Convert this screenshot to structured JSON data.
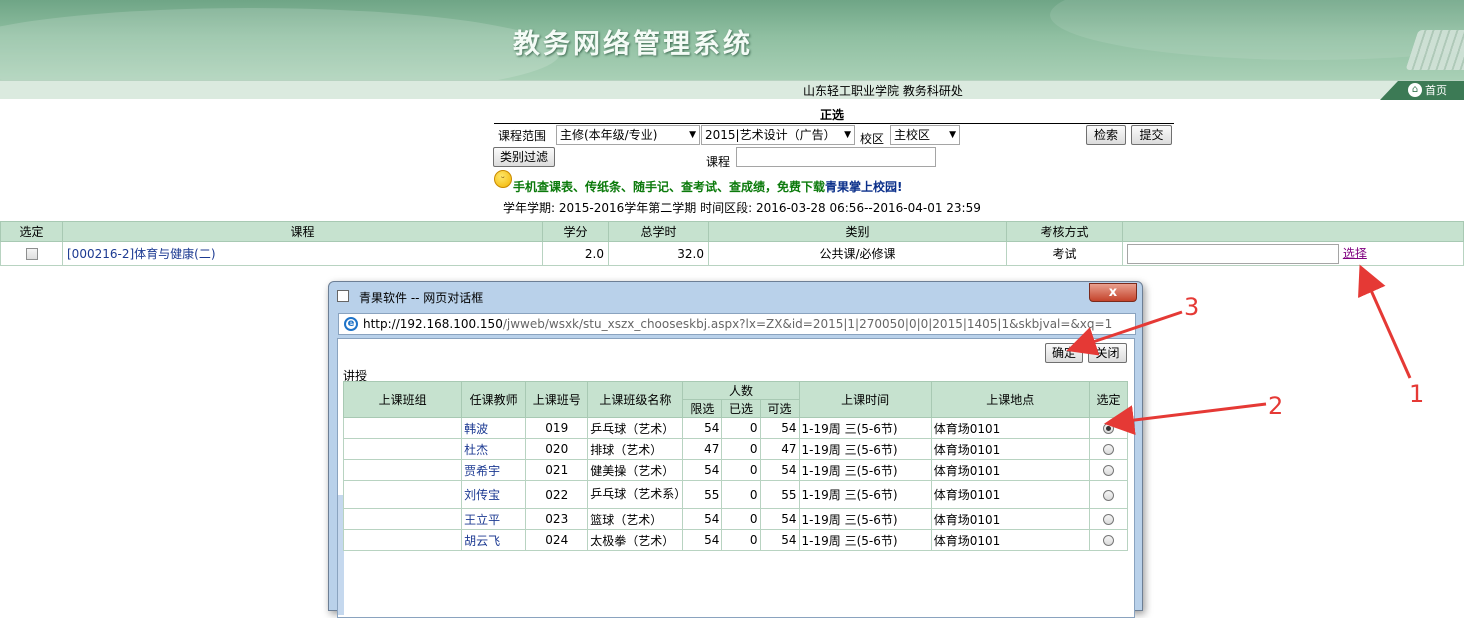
{
  "header": {
    "system_title": "教务网络管理系统",
    "org_line": "山东轻工职业学院 教务科研处",
    "home_label": "首页"
  },
  "form": {
    "heading": "正选",
    "range_label": "课程范围",
    "range_value": "主修(本年级/专业)",
    "class_value": "2015|艺术设计（广告）",
    "campus_label": "校区",
    "campus_value": "主校区",
    "search_label": "检索",
    "submit_label": "提交",
    "filter_label": "类别过滤",
    "course_label": "课程",
    "course_value": ""
  },
  "notice": {
    "part1": "手机查课表、传纸条、随手记、查考试、查成绩，免费下载",
    "part2": "青果掌上校园!"
  },
  "term_line": "学年学期: 2015-2016学年第二学期  时间区段: 2016-03-28 06:56--2016-04-01 23:59",
  "main_table": {
    "headers": [
      "选定",
      "课程",
      "学分",
      "总学时",
      "类别",
      "考核方式"
    ],
    "rows": [
      {
        "course": "[000216-2]体育与健康(二)",
        "credit": "2.0",
        "hours": "32.0",
        "category": "公共课/必修课",
        "exam": "考试",
        "pick": "选择"
      }
    ]
  },
  "dialog": {
    "title": "青果软件 -- 网页对话框",
    "close_label": "x",
    "url_host": "http://192.168.100.150",
    "url_path": "/jwweb/wsxk/stu_xszx_chooseskbj.aspx?lx=ZX&id=2015|1|270050|0|0|2015|1405|1&skbjval=&xq=1",
    "confirm_label": "确定",
    "cancel_label": "关闭",
    "section_label": "讲授",
    "headers": {
      "group": "上课班组",
      "teacher": "任课教师",
      "class_no": "上课班号",
      "class_name": "上课班级名称",
      "people": "人数",
      "limit": "限选",
      "chosen": "已选",
      "available": "可选",
      "time": "上课时间",
      "place": "上课地点",
      "select": "选定"
    },
    "rows": [
      {
        "teacher": "韩波",
        "no": "019",
        "name": "乒乓球（艺术）",
        "limit": "54",
        "chosen": "0",
        "avail": "54",
        "time": "1-19周 三(5-6节)",
        "place": "体育场0101",
        "selected": true
      },
      {
        "teacher": "杜杰",
        "no": "020",
        "name": "排球（艺术）",
        "limit": "47",
        "chosen": "0",
        "avail": "47",
        "time": "1-19周 三(5-6节)",
        "place": "体育场0101",
        "selected": false
      },
      {
        "teacher": "贾希宇",
        "no": "021",
        "name": "健美操（艺术）",
        "limit": "54",
        "chosen": "0",
        "avail": "54",
        "time": "1-19周 三(5-6节)",
        "place": "体育场0101",
        "selected": false
      },
      {
        "teacher": "刘传宝",
        "no": "022",
        "name": "乒乓球（艺术系）",
        "limit": "55",
        "chosen": "0",
        "avail": "55",
        "time": "1-19周 三(5-6节)",
        "place": "体育场0101",
        "selected": false
      },
      {
        "teacher": "王立平",
        "no": "023",
        "name": "篮球（艺术）",
        "limit": "54",
        "chosen": "0",
        "avail": "54",
        "time": "1-19周 三(5-6节)",
        "place": "体育场0101",
        "selected": false
      },
      {
        "teacher": "胡云飞",
        "no": "024",
        "name": "太极拳（艺术）",
        "limit": "54",
        "chosen": "0",
        "avail": "54",
        "time": "1-19周 三(5-6节)",
        "place": "体育场0101",
        "selected": false
      }
    ]
  },
  "annotations": [
    "1",
    "2",
    "3"
  ],
  "colors": {
    "header_green": "#c6e2cf",
    "annotation_red": "#e53935",
    "link_blue": "#1c3a92"
  }
}
